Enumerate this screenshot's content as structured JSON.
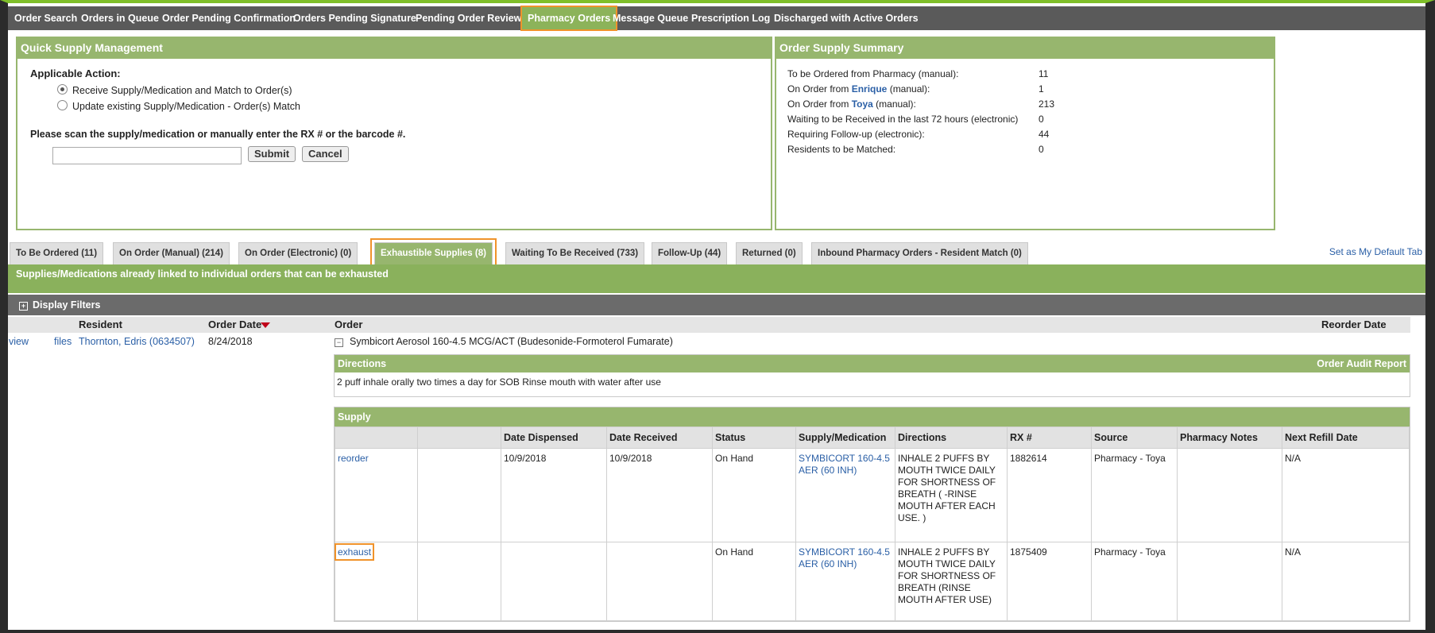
{
  "nav": {
    "items": [
      "Order Search",
      "Orders in Queue",
      "Order Pending Confirmation",
      "Orders Pending Signature",
      "Pending Order Reviews",
      "Pharmacy Orders",
      "Message Queue",
      "Prescription Log",
      "Discharged with Active Orders"
    ],
    "active": "Pharmacy Orders"
  },
  "quick_supply": {
    "title": "Quick Supply Management",
    "action_label": "Applicable Action:",
    "options": [
      {
        "label": "Receive Supply/Medication and Match to Order(s)",
        "checked": true
      },
      {
        "label": "Update existing Supply/Medication - Order(s) Match",
        "checked": false
      }
    ],
    "scan_prompt": "Please scan the supply/medication or manually enter the RX # or the barcode #.",
    "input_value": "",
    "submit_label": "Submit",
    "cancel_label": "Cancel"
  },
  "summary": {
    "title": "Order Supply Summary",
    "rows": [
      {
        "pre": "To be Ordered from Pharmacy (manual):",
        "vendor": "",
        "post": "",
        "value": "11"
      },
      {
        "pre": "On Order from ",
        "vendor": "Enrique",
        "post": " (manual):",
        "value": "1"
      },
      {
        "pre": "On Order from ",
        "vendor": "Toya",
        "post": " (manual):",
        "value": "213"
      },
      {
        "pre": "Waiting to be Received in the last 72 hours (electronic)",
        "vendor": "",
        "post": "",
        "value": "0"
      },
      {
        "pre": "Requiring Follow-up (electronic):",
        "vendor": "",
        "post": "",
        "value": "44"
      },
      {
        "pre": "Residents to be Matched:",
        "vendor": "",
        "post": "",
        "value": "0"
      }
    ]
  },
  "tabs": [
    "To Be Ordered (11)",
    "On Order (Manual) (214)",
    "On Order (Electronic) (0)",
    "Exhaustible Supplies (8)",
    "Waiting To Be Received (733)",
    "Follow-Up (44)",
    "Returned (0)",
    "Inbound Pharmacy Orders - Resident Match (0)"
  ],
  "active_tab": "Exhaustible Supplies (8)",
  "default_tab_link": "Set as My Default Tab",
  "description": "Supplies/Medications already linked to individual orders that can be exhausted",
  "filters_label": "Display Filters",
  "list_headers": {
    "resident": "Resident",
    "order_date": "Order Date",
    "order": "Order",
    "reorder_date": "Reorder Date"
  },
  "order_row": {
    "view": "view",
    "files": "files",
    "resident": "Thornton, Edris (0634507)",
    "order_date": "8/24/2018",
    "order": "Symbicort Aerosol 160-4.5 MCG/ACT (Budesonide-Formoterol Fumarate)"
  },
  "directions": {
    "title": "Directions",
    "audit_link": "Order Audit Report",
    "text": "2 puff inhale orally two times a day for SOB Rinse mouth with water after use"
  },
  "supply": {
    "title": "Supply",
    "headers": [
      "",
      "",
      "Date Dispensed",
      "Date Received",
      "Status",
      "Supply/Medication",
      "Directions",
      "RX #",
      "Source",
      "Pharmacy Notes",
      "Next Refill Date"
    ],
    "rows": [
      {
        "action": "reorder",
        "dispensed": "10/9/2018",
        "received": "10/9/2018",
        "status": "On Hand",
        "medication": "SYMBICORT 160-4.5 AER (60 INH)",
        "directions": "INHALE 2 PUFFS BY MOUTH TWICE DAILY FOR SHORTNESS OF BREATH ( -RINSE MOUTH AFTER EACH USE. )",
        "rx": "1882614",
        "source": "Pharmacy - Toya",
        "notes": "",
        "refill": "N/A"
      },
      {
        "action": "exhaust",
        "dispensed": "",
        "received": "",
        "status": "On Hand",
        "medication": "SYMBICORT 160-4.5 AER (60 INH)",
        "directions": "INHALE 2 PUFFS BY MOUTH TWICE DAILY FOR SHORTNESS OF BREATH (RINSE MOUTH AFTER USE)",
        "rx": "1875409",
        "source": "Pharmacy - Toya",
        "notes": "",
        "refill": "N/A"
      }
    ]
  },
  "colors": {
    "accent": "#97b66e",
    "nav": "#5a5a5a",
    "link": "#2a5fa6",
    "highlight": "#f0932b"
  }
}
